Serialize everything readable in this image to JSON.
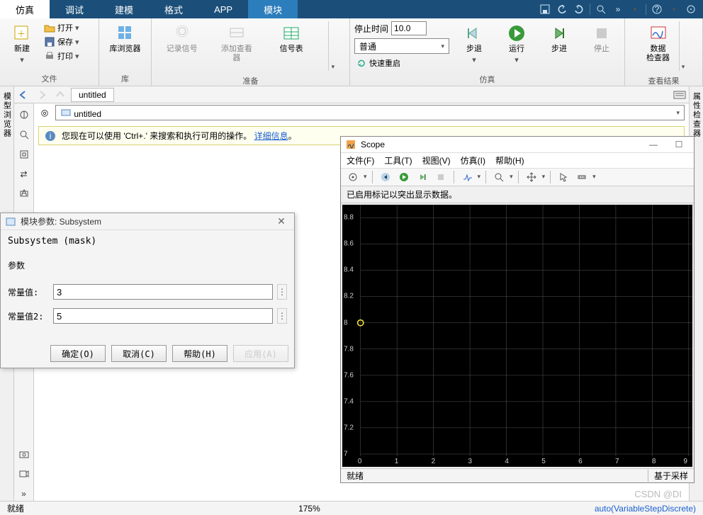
{
  "tabs": [
    "仿真",
    "调试",
    "建模",
    "格式",
    "APP",
    "模块"
  ],
  "active_tab": 0,
  "highlight_tab": 5,
  "ribbon": {
    "new": "新建",
    "open": "打开",
    "save": "保存",
    "print": "打印",
    "file_group": "文件",
    "library_browser": "库浏览器",
    "library_group": "库",
    "log_signal": "记录信号",
    "add_viewer": "添加查看器",
    "signal_table": "信号表",
    "prepare_group": "准备",
    "stop_time_label": "停止时间",
    "stop_time_value": "10.0",
    "mode": "普通",
    "fast_restart": "快速重启",
    "step_back": "步退",
    "run": "运行",
    "step_fwd": "步进",
    "stop": "停止",
    "sim_group": "仿真",
    "data_inspector": "数据\n检查器",
    "results_group": "查看结果"
  },
  "nav": {
    "crumb": "untitled"
  },
  "address": {
    "model": "untitled"
  },
  "info_banner": {
    "prefix": "您现在可以使用 'Ctrl+.' 来搜索和执行可用的操作。",
    "link": "详细信息",
    "suffix": "。"
  },
  "left_panel": "模型浏览器",
  "right_panel": "属性检查器",
  "dialog": {
    "title": "模块参数: Subsystem",
    "mask": "Subsystem (mask)",
    "params_label": "参数",
    "field1_label": "常量值:",
    "field1_value": "3",
    "field2_label": "常量值2:",
    "field2_value": "5",
    "ok": "确定(O)",
    "cancel": "取消(C)",
    "help": "帮助(H)",
    "apply": "应用(A)"
  },
  "scope": {
    "title": "Scope",
    "menus": [
      "文件(F)",
      "工具(T)",
      "视图(V)",
      "仿真(I)",
      "帮助(H)"
    ],
    "msg": "已启用标记以突出显示数据。",
    "status_left": "就绪",
    "status_right": "基于采样",
    "yticks": [
      "8.8",
      "8.6",
      "8.4",
      "8.2",
      "8",
      "7.8",
      "7.6",
      "7.4",
      "7.2",
      "7"
    ],
    "xticks": [
      "0",
      "1",
      "2",
      "3",
      "4",
      "5",
      "6",
      "7",
      "8",
      "9"
    ]
  },
  "status": {
    "ready": "就绪",
    "zoom": "175%",
    "solver": "auto(VariableStepDiscrete)"
  },
  "watermark": "CSDN @DI"
}
